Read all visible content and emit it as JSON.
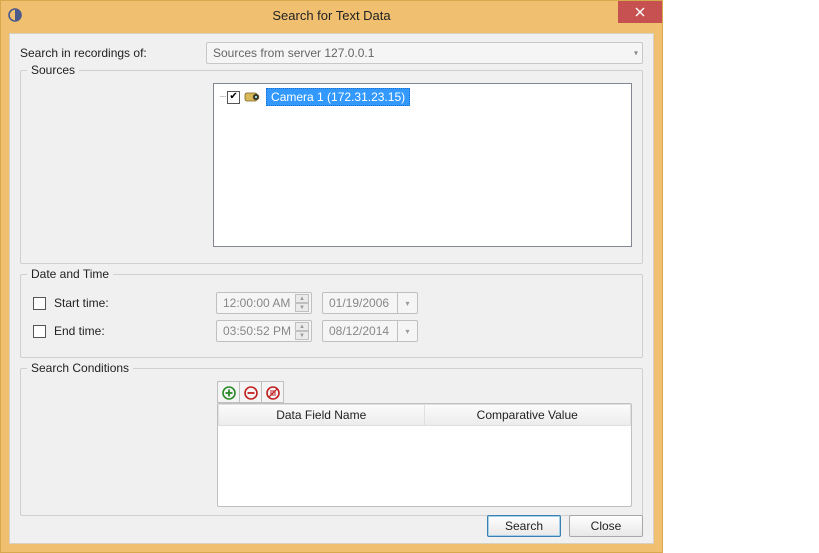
{
  "window": {
    "title": "Search for Text Data"
  },
  "labels": {
    "search_in": "Search in recordings of:",
    "sources": "Sources",
    "date_time": "Date and Time",
    "start_time": "Start time:",
    "end_time": "End time:",
    "search_conditions": "Search Conditions"
  },
  "server_dropdown": {
    "value": "Sources from server 127.0.0.1"
  },
  "tree": {
    "items": [
      {
        "label": "Camera 1 (172.31.23.15)",
        "checked": true
      }
    ]
  },
  "start": {
    "time": "12:00:00 AM",
    "date": "01/19/2006",
    "enabled": false
  },
  "end": {
    "time": "03:50:52 PM",
    "date": "08/12/2014",
    "enabled": false
  },
  "grid": {
    "columns": [
      "Data Field Name",
      "Comparative Value"
    ],
    "rows": []
  },
  "buttons": {
    "search": "Search",
    "close": "Close"
  }
}
